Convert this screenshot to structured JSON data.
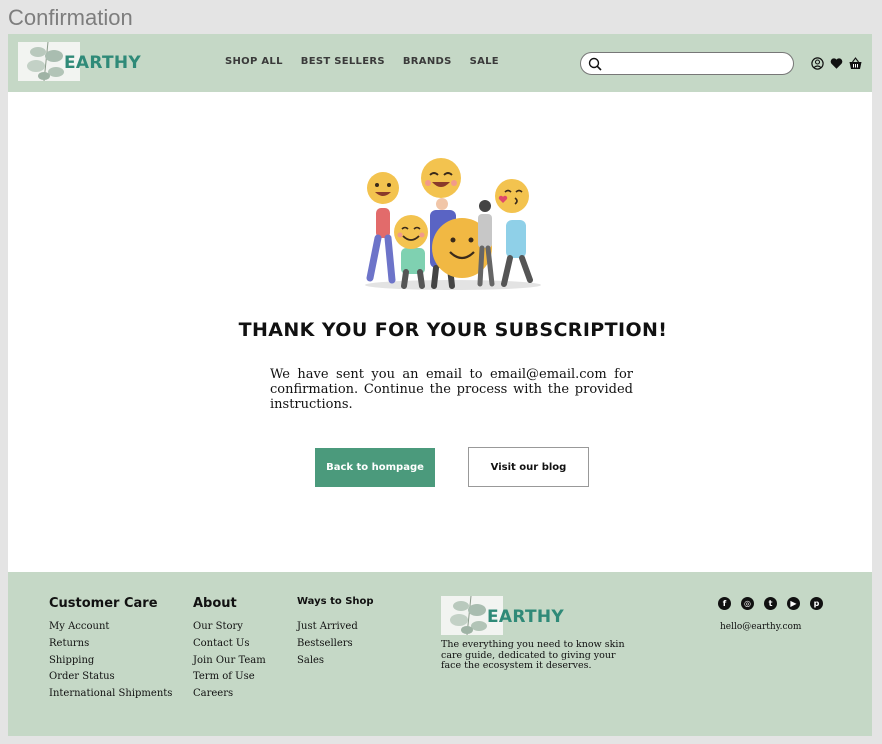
{
  "window": {
    "title": "Confirmation"
  },
  "header": {
    "logo_text": "EARTHY",
    "nav": [
      "SHOP ALL",
      "BEST SELLERS",
      "BRANDS",
      "SALE"
    ],
    "search": {
      "placeholder": "",
      "value": ""
    },
    "icons": [
      "search-icon",
      "user-icon",
      "heart-icon",
      "basket-icon"
    ]
  },
  "main": {
    "illustration": "happy-people-emoji-illustration",
    "heading": "THANK YOU FOR YOUR SUBSCRIPTION!",
    "message": "We have sent you an email to email@email.com for confirmation. Continue the process with the provided instructions.",
    "primary_button": "Back to hompage",
    "secondary_button": "Visit our blog"
  },
  "footer": {
    "columns": [
      {
        "title": "Customer Care",
        "links": [
          "My Account",
          "Returns",
          "Shipping",
          "Order Status",
          "International Shipments"
        ]
      },
      {
        "title": "About",
        "links": [
          "Our Story",
          "Contact Us",
          "Join Our Team",
          "Term of Use",
          "Careers"
        ]
      },
      {
        "title": "Ways to Shop",
        "links": [
          "Just Arrived",
          "Bestsellers",
          "Sales"
        ]
      }
    ],
    "logo_text": "EARTHY",
    "tagline": "The everything you need to know skin care guide, dedicated to giving your face the ecosystem it deserves.",
    "social": [
      "facebook-icon",
      "instagram-icon",
      "twitter-icon",
      "youtube-icon",
      "pinterest-icon"
    ],
    "email": "hello@earthy.com"
  },
  "colors": {
    "brand_green": "#c5d8c6",
    "accent": "#4b9a7c",
    "logo_teal": "#2f8a78"
  }
}
